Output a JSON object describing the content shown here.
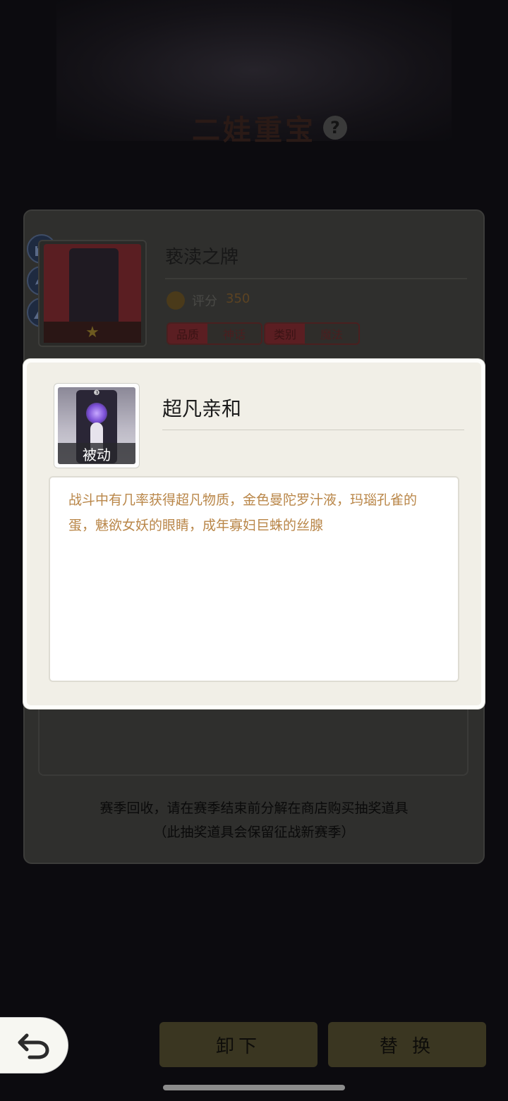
{
  "page": {
    "title": "二娃重宝",
    "help_icon": "question-circle-icon"
  },
  "item": {
    "name": "亵渎之牌",
    "score_label": "评分",
    "score_value": "350",
    "tags": [
      {
        "key": "品质",
        "value": "神话"
      },
      {
        "key": "类别",
        "value": "魔法"
      }
    ],
    "side_tabs": [
      "castle-icon",
      "griffin-icon",
      "mountain-icon"
    ]
  },
  "popup": {
    "badge": "被动",
    "title": "超凡亲和",
    "description": "战斗中有几率获得超凡物质，金色曼陀罗汁液，玛瑙孔雀的蛋，魅欲女妖的眼睛，成年寡妇巨蛛的丝腺",
    "accent_color": "#b98648"
  },
  "notice": {
    "line1": "赛季回收，请在赛季结束前分解在商店购买抽奖道具",
    "line2": "（此抽奖道具会保留征战新赛季）"
  },
  "controls": {
    "back_icon": "undo-arrow-icon",
    "unequip_label": "卸下",
    "replace_label": "替 换"
  }
}
